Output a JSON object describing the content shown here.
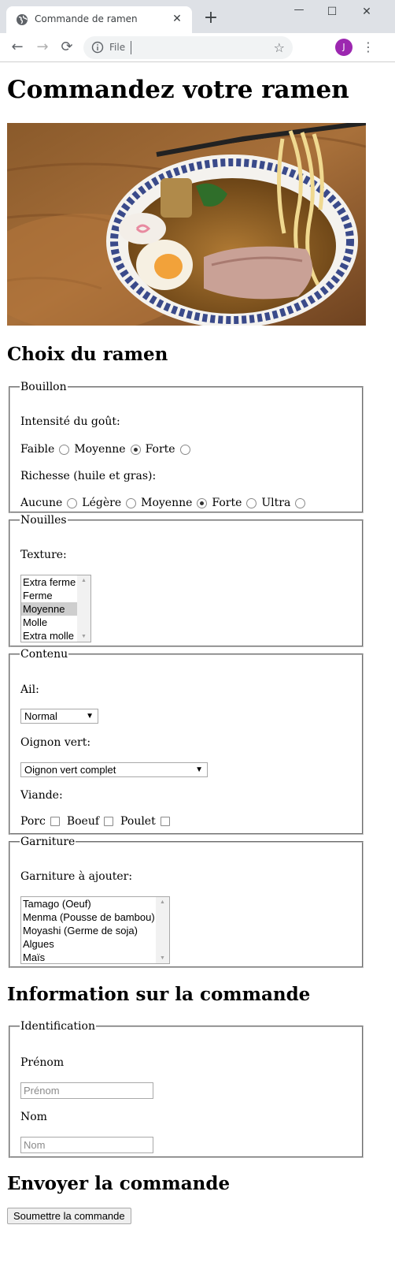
{
  "browser": {
    "tab_title": "Commande de ramen",
    "new_tab": "+",
    "close_tab": "✕",
    "address_scheme": "File",
    "avatar_letter": "J",
    "window": {
      "minimize": "—",
      "maximize": "☐",
      "close": "✕"
    },
    "nav": {
      "back": "←",
      "forward": "→",
      "reload": "⟳",
      "star": "☆",
      "menu": "⋮"
    },
    "avatar_color": "#9c27b0"
  },
  "page": {
    "title": "Commandez votre ramen",
    "image_alt": "ramen bowl photo",
    "choice_heading": "Choix du ramen",
    "bouillon": {
      "legend": "Bouillon",
      "intensity_label": "Intensité du goût:",
      "intensity_options": [
        "Faible",
        "Moyenne",
        "Forte"
      ],
      "intensity_selected": "Moyenne",
      "richness_label": "Richesse (huile et gras):",
      "richness_options": [
        "Aucune",
        "Légère",
        "Moyenne",
        "Forte",
        "Ultra"
      ],
      "richness_selected": "Moyenne"
    },
    "nouilles": {
      "legend": "Nouilles",
      "texture_label": "Texture:",
      "texture_options": [
        "Extra ferme",
        "Ferme",
        "Moyenne",
        "Molle",
        "Extra molle"
      ],
      "texture_selected": "Moyenne"
    },
    "contenu": {
      "legend": "Contenu",
      "ail_label": "Ail:",
      "ail_value": "Normal",
      "oignon_label": "Oignon vert:",
      "oignon_value": "Oignon vert complet",
      "viande_label": "Viande:",
      "viande_options": [
        "Porc",
        "Boeuf",
        "Poulet"
      ]
    },
    "garniture": {
      "legend": "Garniture",
      "label": "Garniture à ajouter:",
      "options": [
        "Tamago (Oeuf)",
        "Menma (Pousse de bambou)",
        "Moyashi (Germe de soja)",
        "Algues",
        "Maïs"
      ]
    },
    "info_heading": "Information sur la commande",
    "identification": {
      "legend": "Identification",
      "prenom_label": "Prénom",
      "prenom_placeholder": "Prénom",
      "nom_label": "Nom",
      "nom_placeholder": "Nom"
    },
    "send_heading": "Envoyer la commande",
    "submit_label": "Soumettre la commande"
  }
}
